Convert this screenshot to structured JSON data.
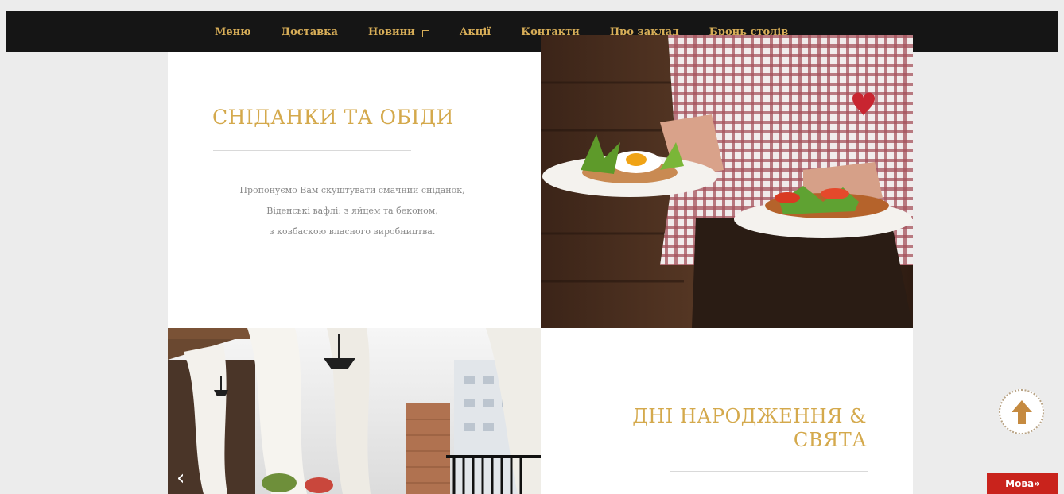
{
  "nav": {
    "items": [
      {
        "label": "Меню"
      },
      {
        "label": "Доставка"
      },
      {
        "label": "Новини",
        "has_dropdown": true
      },
      {
        "label": "Акції"
      },
      {
        "label": "Контакти"
      },
      {
        "label": "Про заклад"
      },
      {
        "label": "Бронь столів"
      }
    ]
  },
  "section1": {
    "title": "СНІДАНКИ ТА ОБІДИ",
    "desc_line1": "Пропонуємо Вам скуштувати смачний сніданок,",
    "desc_line2": "Віденські вафлі: з яйцем та беконом,",
    "desc_line3": "з ковбаскою власного виробництва."
  },
  "section2": {
    "title_line1": "ДНІ НАРОДЖЕННЯ &",
    "title_line2": "СВЯТА"
  },
  "slider": {
    "prev_glyph": "‹"
  },
  "lang_button": {
    "label": "Мова»"
  },
  "colors": {
    "navbar_bg": "#151515",
    "accent_gold": "#d4a94c",
    "lang_red": "#c9231c",
    "page_bg": "#ececec"
  }
}
